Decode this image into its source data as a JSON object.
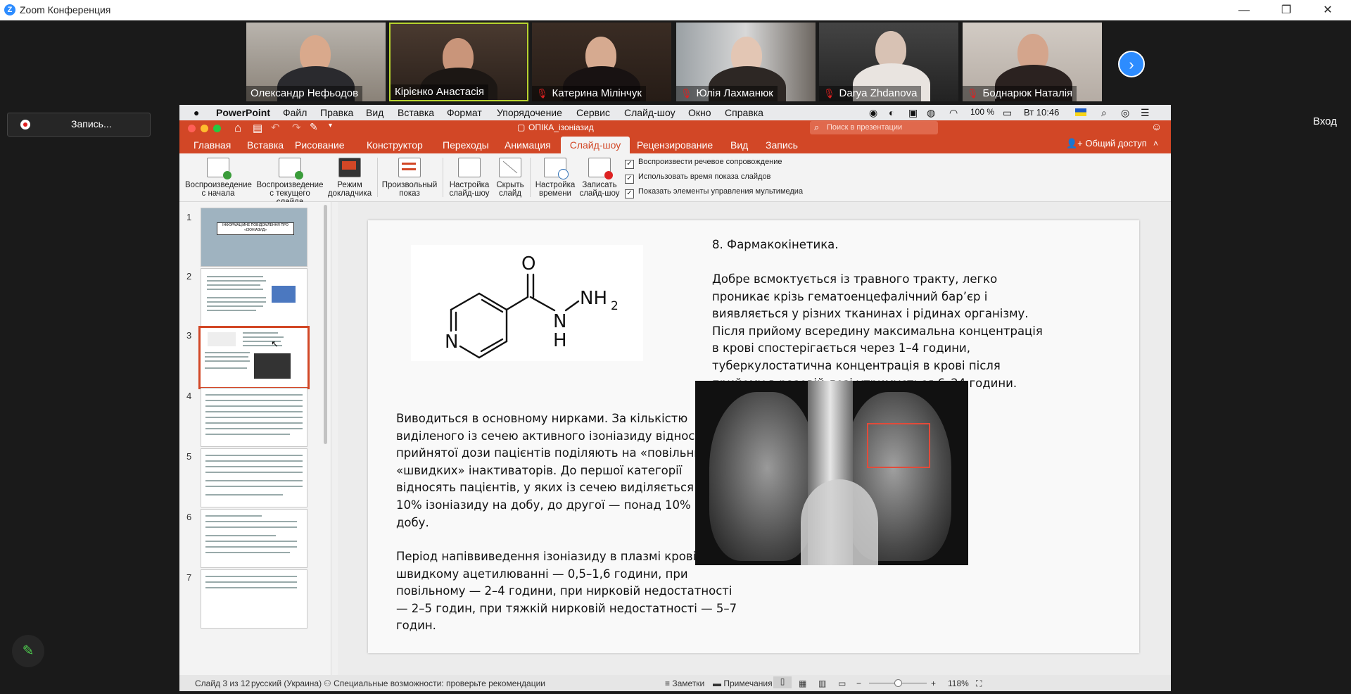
{
  "zoom": {
    "window_title": "Zoom Конференция",
    "participants": [
      {
        "name": "Олександр   Нефьодов",
        "muted": false
      },
      {
        "name": "Кірієнко Анастасія",
        "muted": false
      },
      {
        "name": "Катерина  Мілінчук",
        "muted": true
      },
      {
        "name": "Юлія Лахманюк",
        "muted": true
      },
      {
        "name": "Darya Zhdanova",
        "muted": true
      },
      {
        "name": "Боднарюк Наталія",
        "muted": true
      }
    ],
    "record_label": "Запись...",
    "exit_label": "Вход"
  },
  "mac_menu": {
    "app": "PowerPoint",
    "items": [
      "Файл",
      "Правка",
      "Вид",
      "Вставка",
      "Формат",
      "Упорядочение",
      "Сервис",
      "Слайд-шоу",
      "Окно",
      "Справка"
    ],
    "battery": "100 %",
    "clock": "Вт 10:46"
  },
  "ppt": {
    "doc_title": "ОПІКА_ізоніазид",
    "search_placeholder": "Поиск в презентации",
    "tabs": [
      "Главная",
      "Вставка",
      "Рисование",
      "Конструктор",
      "Переходы",
      "Анимация",
      "Слайд-шоу",
      "Рецензирование",
      "Вид",
      "Запись"
    ],
    "active_tab": "Слайд-шоу",
    "share_label": "Общий доступ",
    "toolbar": {
      "b1": [
        "Воспроизведение",
        "с начала"
      ],
      "b2": [
        "Воспроизведение",
        "с текущего слайда"
      ],
      "b3": [
        "Режим",
        "докладчика"
      ],
      "b4": [
        "Произвольный",
        "показ"
      ],
      "b5": [
        "Настройка",
        "слайд-шоу"
      ],
      "b6": [
        "Скрыть",
        "слайд"
      ],
      "b7": [
        "Настройка",
        "времени"
      ],
      "b8": [
        "Записать",
        "слайд-шоу"
      ]
    },
    "checkboxes": [
      "Воспроизвести речевое сопровождение",
      "Использовать время показа слайдов",
      "Показать элементы управления мультимедиа"
    ],
    "thumb_numbers": [
      "1",
      "2",
      "3",
      "4",
      "5",
      "6",
      "7"
    ],
    "thumb1_title": "ІНФОРМАЦІЙНЕ ПОВІДОМЛЕННЯ ПРО «ІЗОНІАЗИД»",
    "slide": {
      "heading": "8. Фармакокінетика.",
      "para1": "Добре всмоктується із травного тракту, легко\nпроникає крізь гематоенцефалічний бар’єр і\nвиявляється у різних тканинах і рідинах організму.\nПісля прийому всередину максимальна концентрація\nв крові спостерігається через 1–4 години,\nтуберкулостатична концентрація в крові після\nприйому в разовій дозі утримується 6–24 години.",
      "para2": "Виводиться в основному нирками. За кількістю\nвиділеного із сечею активного ізоніазиду відносно\nприйнятої дози пацієнтів поділяють на «повільних» і\n«швидких» інактиваторів. До першої категорії\nвідносять пацієнтів, у яких із сечею виділяється до\n10% ізоніазиду на добу, до другої — понад 10% на\nдобу.",
      "para3": "Період напіввиведення ізоніазиду в плазмі крові при\nшвидкому ацетилюванні — 0,5–1,6 години, при\nповільному — 2–4 години, при нирковій недостатності\n— 2–5 годин, при тяжкій нирковій недостатності — 5–7\nгодин.",
      "mol": {
        "o": "O",
        "n": "N",
        "h": "H",
        "nh": "NH",
        "sub2": "2",
        "ring_n": "N"
      }
    },
    "status": {
      "slide_info": "Слайд 3 из 12",
      "language": "русский (Украина)",
      "accessibility": "Специальные возможности: проверьте рекомендации",
      "notes": "Заметки",
      "comments": "Примечания",
      "zoom": "118%"
    }
  }
}
